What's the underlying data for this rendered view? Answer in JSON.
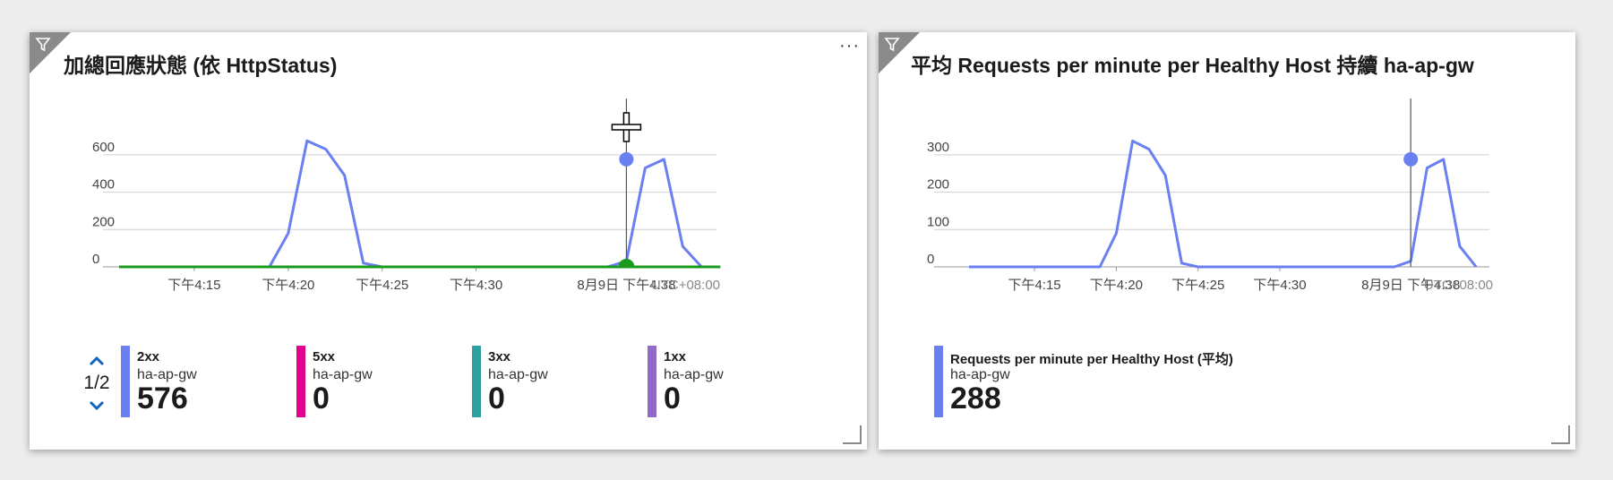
{
  "colors": {
    "2xx": "#6a7ff0",
    "5xx": "#e3008c",
    "3xx": "#2ea0a0",
    "1xx": "#8f6ac8",
    "zero_line": "#1a9a1a",
    "requests": "#6a7ff0"
  },
  "icons": [
    "filter-icon",
    "more-icon",
    "chevron-up-icon",
    "chevron-down-icon",
    "resize-handle-icon",
    "crosshair-cursor-icon"
  ],
  "left_tile": {
    "title": "加總回應狀態 (依 HttpStatus)",
    "more": "···",
    "timezone": "UTC+08:00",
    "page_indicator": "1/2",
    "legend": [
      {
        "name": "2xx",
        "resource": "ha-ap-gw",
        "value": "576",
        "color_key": "2xx"
      },
      {
        "name": "5xx",
        "resource": "ha-ap-gw",
        "value": "0",
        "color_key": "5xx"
      },
      {
        "name": "3xx",
        "resource": "ha-ap-gw",
        "value": "0",
        "color_key": "3xx"
      },
      {
        "name": "1xx",
        "resource": "ha-ap-gw",
        "value": "0",
        "color_key": "1xx"
      }
    ]
  },
  "right_tile": {
    "title": "平均 Requests per minute per Healthy Host 持續 ha-ap-gw",
    "timezone": "UTC+08:00",
    "legend": [
      {
        "name": "Requests per minute per Healthy Host (平均)",
        "resource": "ha-ap-gw",
        "value": "288",
        "color_key": "requests"
      }
    ]
  },
  "chart_data": [
    {
      "type": "line",
      "title": "加總回應狀態 (依 HttpStatus)",
      "x_tick_labels": [
        "下午4:15",
        "下午4:20",
        "下午4:25",
        "下午4:30",
        "8月9日 下午4:38"
      ],
      "x_tick_minutes": [
        15,
        20,
        25,
        30,
        38
      ],
      "x_range": [
        11,
        42.7
      ],
      "ylim": [
        0,
        700
      ],
      "y_ticks": [
        0,
        200,
        400,
        600
      ],
      "grid": true,
      "cursor_x": 38,
      "series": [
        {
          "name": "2xx",
          "color_key": "2xx",
          "x": [
            19,
            20,
            21,
            22,
            23,
            24,
            25,
            26,
            37,
            38,
            39,
            40,
            41,
            42,
            43
          ],
          "values": [
            0,
            180,
            675,
            630,
            490,
            20,
            0,
            0,
            0,
            30,
            530,
            576,
            110,
            0,
            0
          ]
        },
        {
          "name": "5xx / 3xx / 1xx",
          "color_key": "zero_line",
          "x": [
            11,
            43
          ],
          "values": [
            0,
            0
          ]
        }
      ]
    },
    {
      "type": "line",
      "title": "平均 Requests per minute per Healthy Host 持續 ha-ap-gw",
      "x_tick_labels": [
        "下午4:15",
        "下午4:20",
        "下午4:25",
        "下午4:30",
        "8月9日 下午4:38"
      ],
      "x_tick_minutes": [
        15,
        20,
        25,
        30,
        38
      ],
      "x_range": [
        11,
        42.7
      ],
      "ylim": [
        0,
        350
      ],
      "y_ticks": [
        0,
        100,
        200,
        300
      ],
      "grid": true,
      "cursor_x": 38,
      "series": [
        {
          "name": "Requests per minute per Healthy Host (平均)",
          "color_key": "requests",
          "x": [
            11,
            19,
            20,
            21,
            22,
            23,
            24,
            25,
            26,
            37,
            38,
            39,
            40,
            41,
            42
          ],
          "values": [
            0,
            0,
            90,
            337,
            315,
            245,
            10,
            0,
            0,
            0,
            15,
            265,
            288,
            55,
            0
          ]
        }
      ]
    }
  ]
}
